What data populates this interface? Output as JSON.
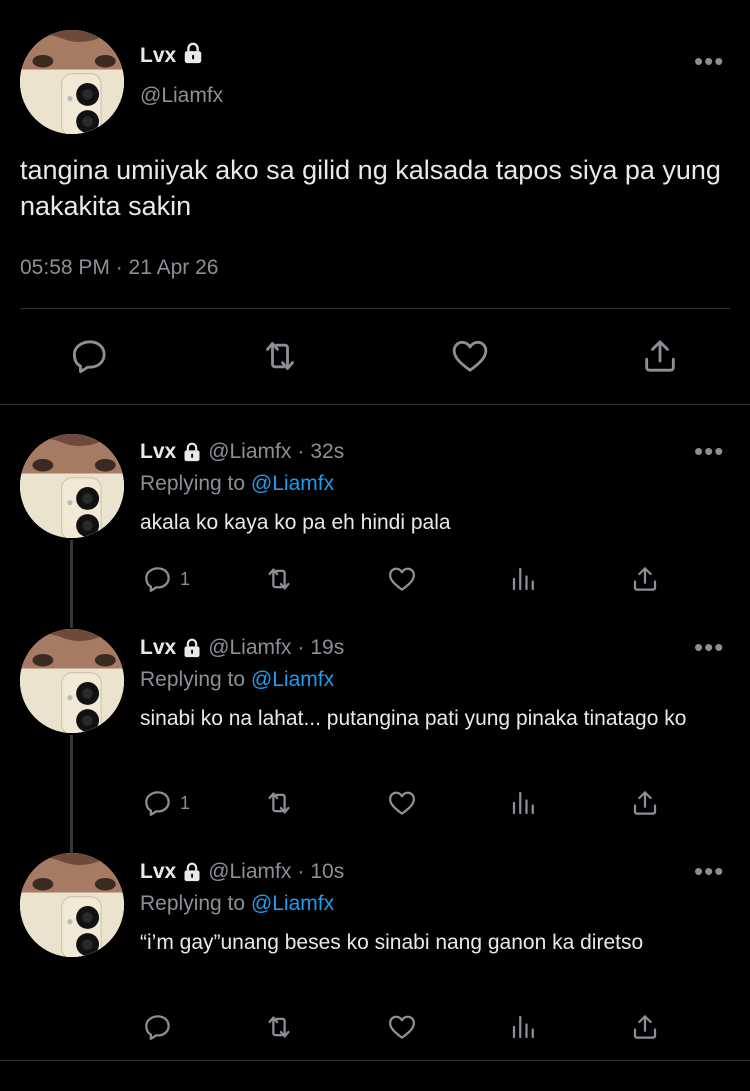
{
  "tweet": {
    "name": "Lvx",
    "handle": "@Liamfx",
    "text": "tangina umiiyak ako sa gilid ng kalsada tapos siya pa yung nakakita sakin",
    "timestamp": "05:58 PM · 21 Apr 26",
    "icons": [
      "reply-icon",
      "retweet-icon",
      "like-icon",
      "share-icon"
    ]
  },
  "replies": [
    {
      "name": "Lvx",
      "handle": "@Liamfx",
      "dot": "·",
      "time": "32s",
      "replying_prefix": "Replying to ",
      "replying_to": "@Liamfx",
      "text": "akala ko kaya ko pa eh hindi pala",
      "reply_count": "1"
    },
    {
      "name": "Lvx",
      "handle": "@Liamfx",
      "dot": "·",
      "time": "19s",
      "replying_prefix": "Replying to ",
      "replying_to": "@Liamfx",
      "text": "sinabi ko na lahat... putangina pati yung pinaka tinatago ko",
      "reply_count": "1"
    },
    {
      "name": "Lvx",
      "handle": "@Liamfx",
      "dot": "·",
      "time": "10s",
      "replying_prefix": "Replying to ",
      "replying_to": "@Liamfx",
      "text": "“i’m gay”unang beses ko sinabi nang ganon ka diretso",
      "reply_count": ""
    }
  ],
  "more_label": "•••",
  "colors": {
    "background": "#000000",
    "text": "#e7e9ea",
    "muted": "#8b9096",
    "link": "#1d9bf0",
    "divider": "#2f3336"
  }
}
